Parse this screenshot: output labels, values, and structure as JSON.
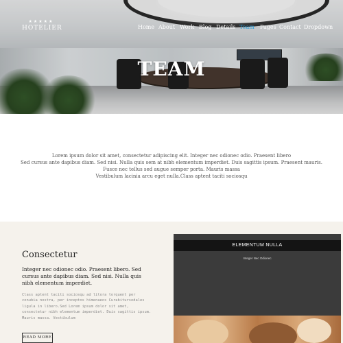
{
  "brand": {
    "stars": "★★★★★",
    "name": "HOTELIER"
  },
  "nav": {
    "items": [
      {
        "label": "Home",
        "active": false
      },
      {
        "label": "About",
        "active": false
      },
      {
        "label": "Work",
        "active": false
      },
      {
        "label": "Blog",
        "active": false
      },
      {
        "label": "Details",
        "active": false
      },
      {
        "label": "Team",
        "active": true
      },
      {
        "label": "Pages",
        "active": false
      },
      {
        "label": "Contact",
        "active": false
      },
      {
        "label": "Dropdown",
        "active": false
      }
    ]
  },
  "hero": {
    "title": "TEAM"
  },
  "intro": {
    "lines": [
      "Lorem ipsum dolor sit amet, consectetur adipiscing elit. Integer nec odionec odio. Praesent libero",
      "Sed cursus ante dapibus diam. Sed nisi. Nulla quis sem at nibh elementum imperdiet. Duis sagittis ipsum. Praesent mauris.",
      "Fusce nec tellus sed augue semper porta. Mauris massa",
      "Vestibulum lacinia arcu eget nulla.Class aptent taciti sociosqu"
    ]
  },
  "feature": {
    "heading": "Consectetur",
    "lead": "Integer nec odionec odio. Praesent libero. Sed cursus ante dapibus diam. Sed nisi. Nulla quis nibh elementum imperdiet.",
    "body": "Class aptent taciti sociosqu ad litora torquent per conubia nostra, per inceptos himenaeos Curabitursodales ligula in libero.Sed Lorem ipsum dolor sit amet, consectetur nibh elementum imperdiet. Duis sagittis ipsum. Mauris massa. Vestibulum",
    "button": "READ MORE"
  },
  "panel": {
    "title": "ELEMENTUM NULLA",
    "subtitle": "Integer Nec Odionec"
  },
  "colors": {
    "accent": "#2f9fd8",
    "lower_bg": "#f5f2ec",
    "panel_bg": "#3b3b3b",
    "panel_head": "#141414"
  }
}
